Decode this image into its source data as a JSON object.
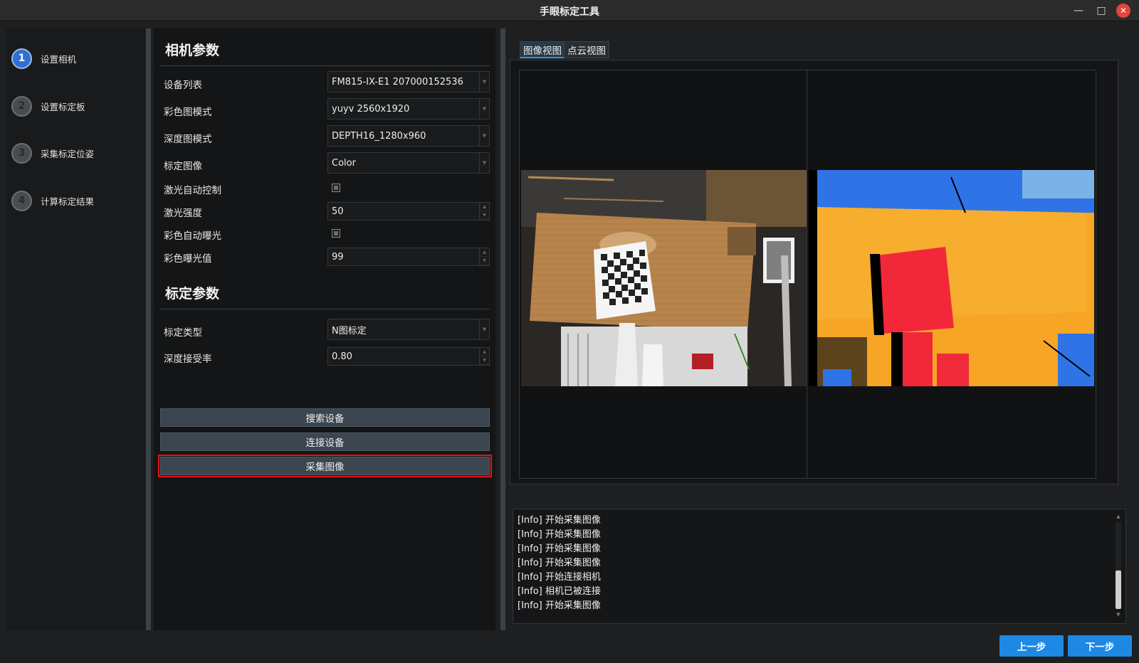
{
  "window": {
    "title": "手眼标定工具",
    "minimize_icon": "minimize-icon",
    "maximize_icon": "maximize-icon",
    "close_icon": "close-icon"
  },
  "steps": [
    {
      "num": "1",
      "label": "设置相机",
      "active": true
    },
    {
      "num": "2",
      "label": "设置标定板",
      "active": false
    },
    {
      "num": "3",
      "label": "采集标定位姿",
      "active": false
    },
    {
      "num": "4",
      "label": "计算标定结果",
      "active": false
    }
  ],
  "camera_params": {
    "title": "相机参数",
    "device_list": {
      "label": "设备列表",
      "value": "FM815-IX-E1 207000152536"
    },
    "color_mode": {
      "label": "彩色图模式",
      "value": "yuyv 2560x1920"
    },
    "depth_mode": {
      "label": "深度图模式",
      "value": "DEPTH16_1280x960"
    },
    "calib_image": {
      "label": "标定图像",
      "value": "Color"
    },
    "laser_auto": {
      "label": "激光自动控制",
      "checked": false
    },
    "laser_strength": {
      "label": "激光强度",
      "value": "50"
    },
    "color_auto_exposure": {
      "label": "彩色自动曝光",
      "checked": false
    },
    "color_exposure": {
      "label": "彩色曝光值",
      "value": "99"
    }
  },
  "calib_params": {
    "title": "标定参数",
    "calib_type": {
      "label": "标定类型",
      "value": "N图标定"
    },
    "depth_accept": {
      "label": "深度接受率",
      "value": "0.80"
    }
  },
  "actions": {
    "search": "搜索设备",
    "connect": "连接设备",
    "capture": "采集图像"
  },
  "viewer": {
    "tabs": [
      "图像视图",
      "点云视图"
    ],
    "active_tab": 0
  },
  "log": [
    "[Info] 开始采集图像",
    "[Info] 开始采集图像",
    "[Info] 开始采集图像",
    "[Info] 开始采集图像",
    "[Info] 开始连接相机",
    "[Info] 相机已被连接",
    "[Info] 开始采集图像"
  ],
  "nav": {
    "prev": "上一步",
    "next": "下一步"
  },
  "colors": {
    "accent": "#1e88e5",
    "highlight": "#e3141b",
    "active_step": "#2f6fd6"
  }
}
